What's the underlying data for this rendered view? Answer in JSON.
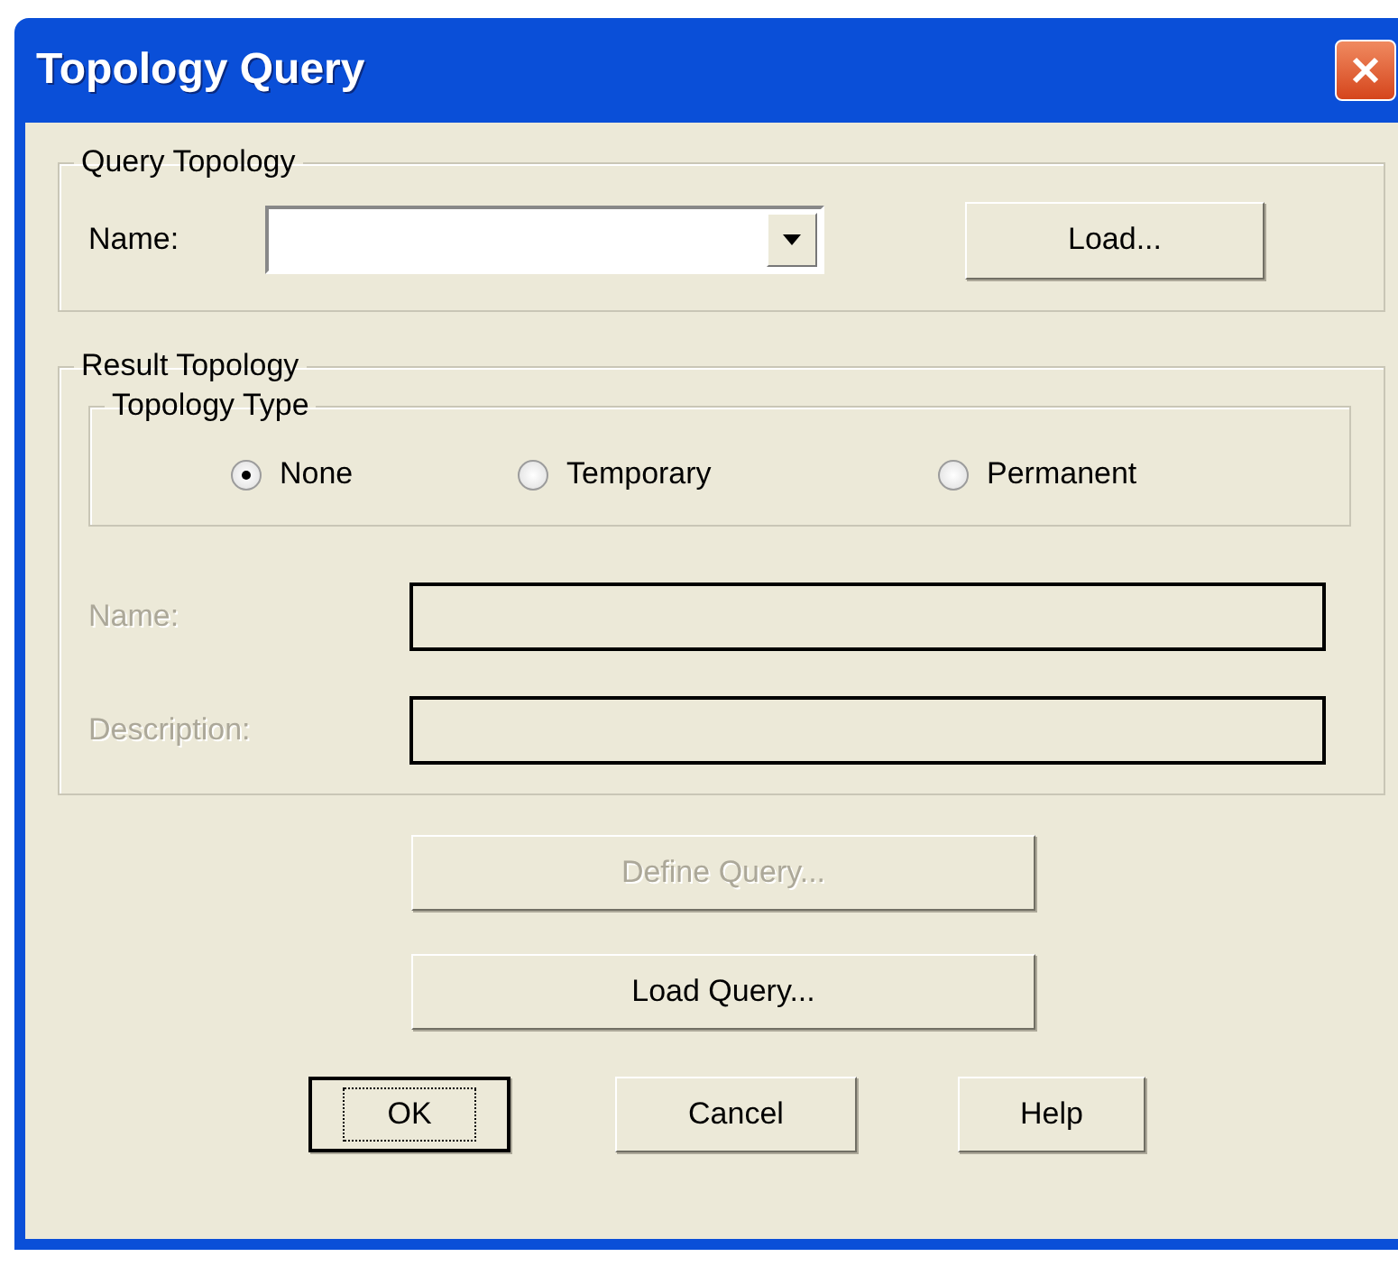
{
  "window": {
    "title": "Topology Query"
  },
  "query_topology": {
    "title": "Query Topology",
    "name_label": {
      "text": "Name:"
    },
    "load_button": {
      "label": "Load...",
      "disabled": false
    }
  },
  "result_topology": {
    "title": "Result Topology",
    "topology_type": {
      "title": "Topology Type",
      "options": [
        {
          "label": "None",
          "selected": true
        },
        {
          "label": "Temporary",
          "selected": false
        },
        {
          "label": "Permanent",
          "selected": false
        }
      ]
    },
    "fields": [
      {
        "label": "Name:",
        "disabled": true
      },
      {
        "label": "Description:",
        "disabled": true
      }
    ]
  },
  "buttons": [
    {
      "label": "Define Query...",
      "disabled": true
    },
    {
      "label": "Load Query...",
      "disabled": false
    }
  ],
  "dialog_buttons": [
    {
      "label": "OK",
      "default": true,
      "disabled": false
    },
    {
      "label": "Cancel",
      "default": false,
      "disabled": false
    },
    {
      "label": "Help",
      "default": false,
      "disabled": false
    }
  ]
}
